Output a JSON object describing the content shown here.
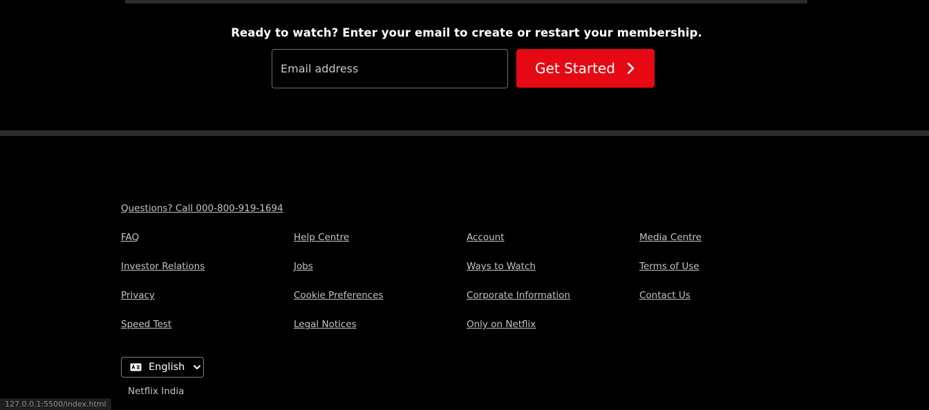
{
  "cta": {
    "title": "Ready to watch? Enter your email to create or restart your membership.",
    "email_placeholder": "Email address",
    "button_label": "Get Started"
  },
  "footer": {
    "questions": "Questions? Call 000-800-919-1694",
    "columns": [
      [
        "FAQ",
        "Investor Relations",
        "Privacy",
        "Speed Test"
      ],
      [
        "Help Centre",
        "Jobs",
        "Cookie Preferences",
        "Legal Notices"
      ],
      [
        "Account",
        "Ways to Watch",
        "Corporate Information",
        "Only on Netflix"
      ],
      [
        "Media Centre",
        "Terms of Use",
        "Contact Us"
      ]
    ],
    "language": "English",
    "country": "Netflix India"
  },
  "status_bar": {
    "url": "127.0.0.1:5500/index.html"
  },
  "colors": {
    "accent": "#e50914",
    "background": "#000000",
    "link": "#c4c4c4"
  }
}
